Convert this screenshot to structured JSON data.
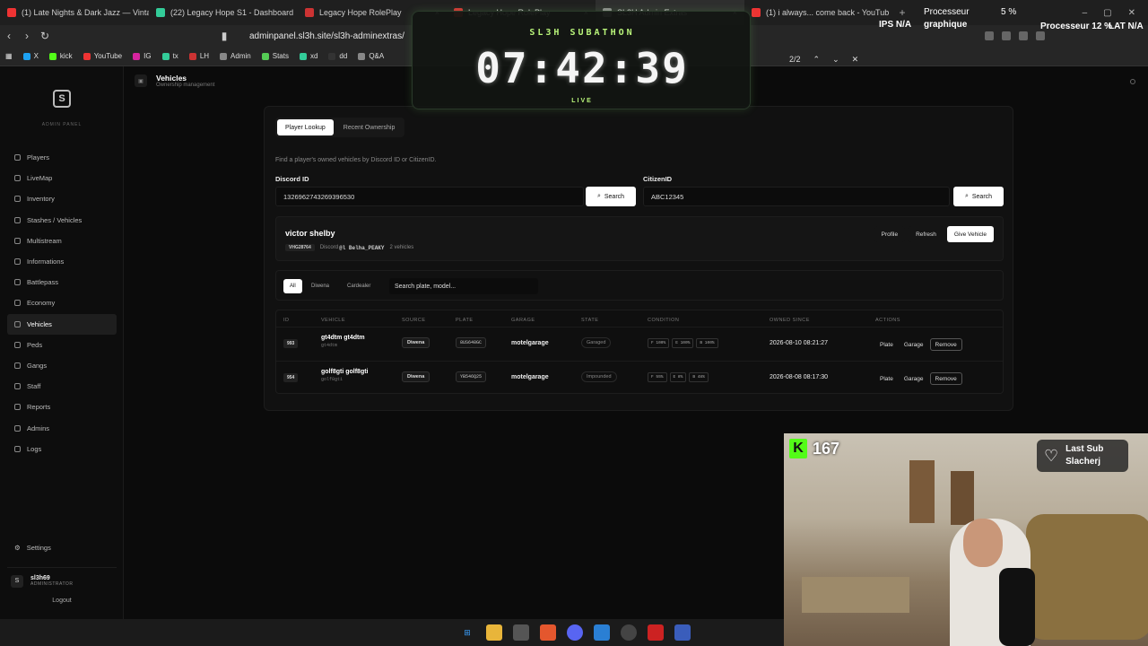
{
  "browser": {
    "tabs": [
      {
        "title": "(1) Late Nights & Dark Jazz — Vintag",
        "color": "#e33"
      },
      {
        "title": "(22) Legacy Hope S1 - Dashboard",
        "color": "#3c9"
      },
      {
        "title": "Legacy Hope RolePlay",
        "color": "#c33"
      },
      {
        "title": "Legacy Hope RolePlay",
        "color": "#c33"
      },
      {
        "title": "SL3H Admin Extras",
        "color": "#888"
      },
      {
        "title": "(1) i always... come back - YouTub",
        "color": "#e33"
      }
    ],
    "url": "adminpanel.sl3h.site/sl3h-adminextras/",
    "find_count": "2/2",
    "bookmarks": [
      {
        "label": "X",
        "color": "#1da1f2"
      },
      {
        "label": "kick",
        "color": "#53fc18"
      },
      {
        "label": "YouTube",
        "color": "#e33"
      },
      {
        "label": "IG",
        "color": "#d6249f"
      },
      {
        "label": "tx",
        "color": "#3c9"
      },
      {
        "label": "LH",
        "color": "#c33"
      },
      {
        "label": "Admin",
        "color": "#888"
      },
      {
        "label": "Stats",
        "color": "#5c5"
      },
      {
        "label": "xd",
        "color": "#3c9"
      },
      {
        "label": "dd",
        "color": "#333"
      },
      {
        "label": "Q&A",
        "color": "#888"
      }
    ]
  },
  "overlay": {
    "ips": "IPS N/A",
    "graph": "graphique",
    "proc": "Processeur",
    "proc_pct": "5 %",
    "proc2": "Processeur 12 %",
    "lat": "LAT N/A"
  },
  "sidebar": {
    "logo_text": "ADMIN PANEL",
    "items": [
      "Players",
      "LiveMap",
      "Inventory",
      "Stashes / Vehicles",
      "Multistream",
      "Informations",
      "Battlepass",
      "Economy",
      "Vehicles",
      "Peds",
      "Gangs",
      "Staff",
      "Reports",
      "Admins",
      "Logs"
    ],
    "settings": "Settings",
    "user": {
      "initial": "S",
      "name": "sl3h69",
      "role": "ADMINISTRATOR"
    },
    "logout": "Logout"
  },
  "header": {
    "title": "Vehicles",
    "subtitle": "Ownership management"
  },
  "tabs": [
    "Player Lookup",
    "Recent Ownership"
  ],
  "hint": "Find a player's owned vehicles by Discord ID or CitizenID.",
  "discord": {
    "label": "Discord ID",
    "value": "1326962743269396530"
  },
  "citizen": {
    "label": "CitizenID",
    "value": "ABC12345"
  },
  "search_label": "Search",
  "player": {
    "name": "victor shelby",
    "cid": "VHG28764",
    "discord_prefix": "Discord",
    "discord_tag": "@l Belha_PEAKY",
    "vehicles": "2 vehicles",
    "buttons": [
      "Profile",
      "Refresh",
      "Give Vehicle"
    ]
  },
  "filters": [
    "All",
    "Diwena",
    "Cardealer"
  ],
  "filter_search": "Search plate, model...",
  "columns": [
    "ID",
    "VEHICLE",
    "SOURCE",
    "PLATE",
    "GARAGE",
    "STATE",
    "CONDITION",
    "OWNED SINCE",
    "ACTIONS"
  ],
  "rows": [
    {
      "id": "993",
      "name": "gt4dtm gt4dtm",
      "model": "gt4dtm",
      "source": "Diwena",
      "plate": "8US648GC",
      "garage": "motelgarage",
      "state": "Garaged",
      "cond": [
        "F 100%",
        "E 100%",
        "B 100%"
      ],
      "since": "2026-08-10 08:21:27"
    },
    {
      "id": "954",
      "name": "golf8gti golf8gti",
      "model": "golf8gti",
      "source": "Diwena",
      "plate": "YB546Q25",
      "garage": "motelgarage",
      "state": "Impounded",
      "cond": [
        "F 55%",
        "E 8%",
        "B 48%"
      ],
      "since": "2026-08-08 08:17:30"
    }
  ],
  "actions": [
    "Plate",
    "Garage",
    "Remove"
  ],
  "timer": {
    "title": "SL3H SUBATHON",
    "time": "07:42:39",
    "status": "LIVE"
  },
  "stream": {
    "kick_count": "167",
    "last_sub_label": "Last Sub",
    "last_sub_name": "Slacherj"
  }
}
